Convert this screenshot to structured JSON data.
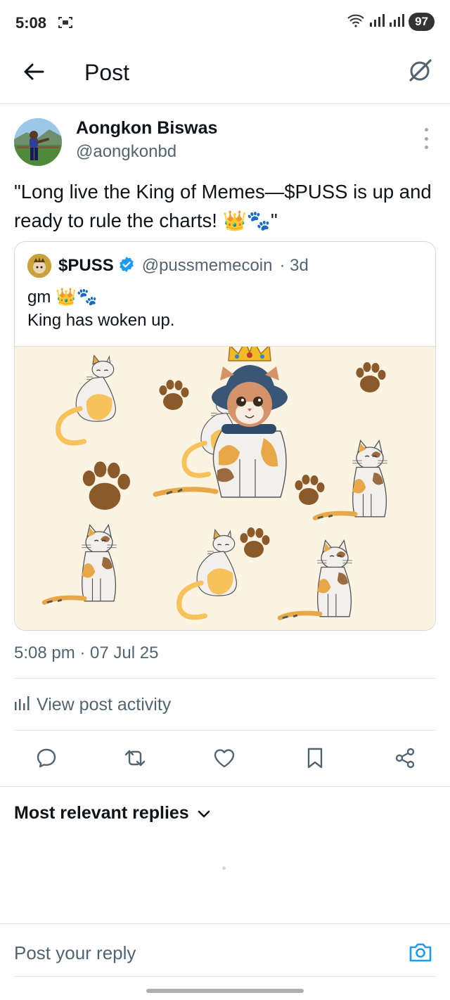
{
  "status_bar": {
    "time": "5:08",
    "battery": "97"
  },
  "header": {
    "title": "Post",
    "back_icon": "arrow-left-icon",
    "grok_icon": "grok-icon"
  },
  "post": {
    "author_name": "Aongkon Biswas",
    "author_handle": "@aongkonbd",
    "text": "\"Long live the King of Memes—$PUSS is up and ready to rule the charts! 👑🐾\"",
    "quote": {
      "name": "$PUSS",
      "handle": "@pussmemecoin",
      "age": "· 3d",
      "line1": "gm 👑🐾",
      "line2": "King has woken up."
    },
    "timestamp": "5:08 pm · 07 Jul 25",
    "activity_label": "View post activity"
  },
  "actions": [
    "reply-icon",
    "repost-icon",
    "like-icon",
    "bookmark-icon",
    "share-icon"
  ],
  "replies": {
    "sort_label": "Most relevant replies"
  },
  "composer": {
    "placeholder": "Post your reply"
  },
  "colors": {
    "accent": "#1d9bf0",
    "text": "#0f1419",
    "muted": "#536471",
    "image_bg": "#fdf3e3",
    "paw": "#8b5a2b"
  }
}
